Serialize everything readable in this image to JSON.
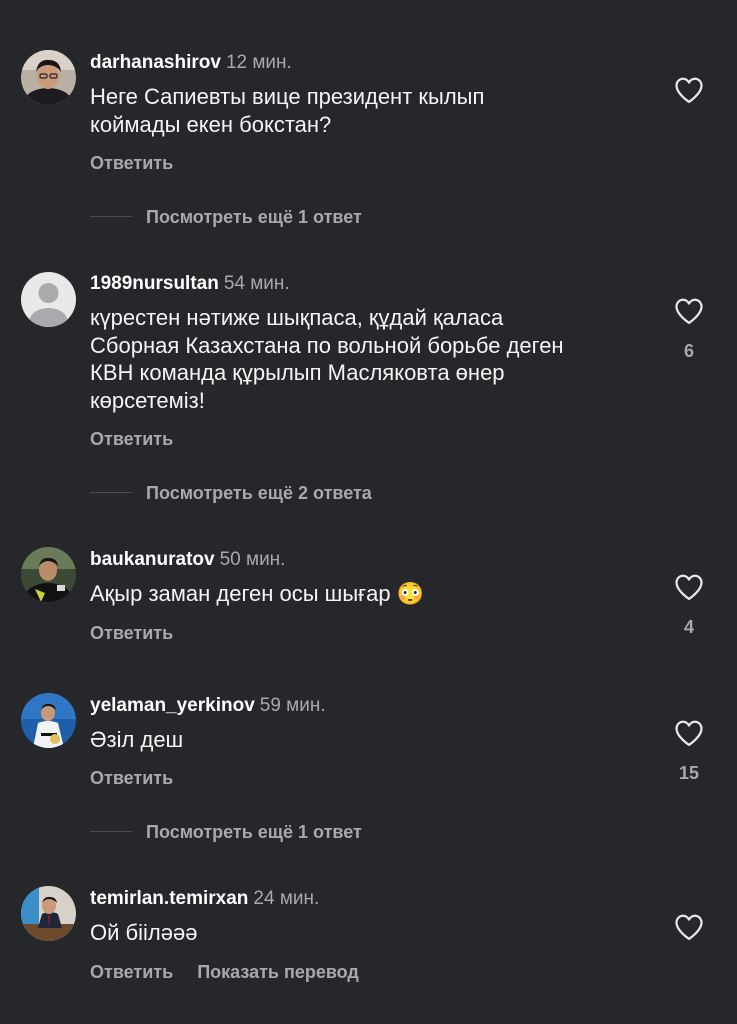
{
  "comments": [
    {
      "username": "darhanashirov",
      "time": "12 мин.",
      "text_lines": [
        "Неге Сапиевты вице президент кылып",
        "коймады екен бокстан?"
      ],
      "likes": "",
      "actions": {
        "reply": "Ответить"
      },
      "more_replies": "Посмотреть ещё 1 ответ"
    },
    {
      "username": "1989nursultan",
      "time": "54 мин.",
      "text_lines": [
        "күрестен нәтиже шықпаса, құдай қаласа",
        "Сборная Казахстана по вольной борьбе деген",
        "КВН команда құрылып Масляковта өнер",
        "көрсетеміз!"
      ],
      "likes": "6",
      "actions": {
        "reply": "Ответить"
      },
      "more_replies": "Посмотреть ещё 2 ответа"
    },
    {
      "username": "baukanuratov",
      "time": "50 мин.",
      "text_lines": [
        "Ақыр заман деген осы шығар 😳"
      ],
      "likes": "4",
      "actions": {
        "reply": "Ответить"
      }
    },
    {
      "username": "yelaman_yerkinov",
      "time": "59 мин.",
      "text_lines": [
        "Әзіл деш"
      ],
      "likes": "15",
      "actions": {
        "reply": "Ответить"
      },
      "more_replies": "Посмотреть ещё 1 ответ"
    },
    {
      "username": "temirlan.temirxan",
      "time": "24 мин.",
      "text_lines": [
        "Ой бііләәә"
      ],
      "likes": "",
      "actions": {
        "reply": "Ответить",
        "translate": "Показать перевод"
      }
    }
  ],
  "icons": {
    "like": "heart-outline-icon",
    "default_avatar": "default-avatar-icon"
  },
  "colors": {
    "background": "#26272b",
    "primary_text": "#f5f5f5",
    "secondary_text": "#a8a9ad"
  }
}
